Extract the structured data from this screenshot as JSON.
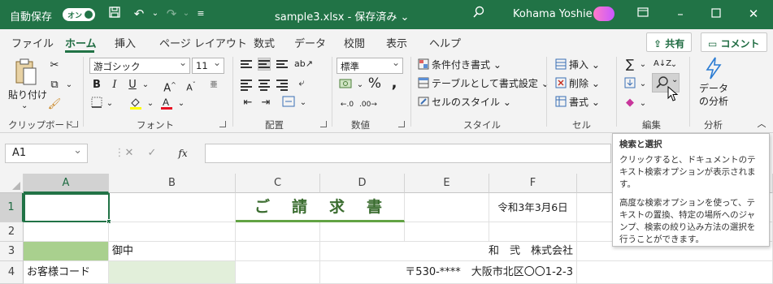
{
  "titlebar": {
    "autosave_label": "自動保存",
    "autosave_state": "オン",
    "filename": "sample3.xlsx - 保存済み ⌄",
    "user": "Kohama Yoshie",
    "bg_color": "#217346"
  },
  "tabs": [
    "ファイル",
    "ホーム",
    "挿入",
    "ページ レイアウト",
    "数式",
    "データ",
    "校閲",
    "表示",
    "ヘルプ"
  ],
  "active_tab": "ホーム",
  "share_label": "共有",
  "comment_label": "コメント",
  "ribbon": {
    "clipboard": {
      "paste": "貼り付け",
      "label": "クリップボード"
    },
    "font": {
      "name": "游ゴシック",
      "size": "11",
      "label": "フォント"
    },
    "alignment": {
      "label": "配置"
    },
    "number": {
      "format": "標準",
      "label": "数値"
    },
    "styles": {
      "conditional": "条件付き書式",
      "table": "テーブルとして書式設定",
      "cell_style": "セルのスタイル",
      "label": "スタイル"
    },
    "cells": {
      "insert": "挿入",
      "delete": "削除",
      "format": "書式",
      "label": "セル"
    },
    "editing": {
      "label": "編集"
    },
    "analysis": {
      "btn_line1": "データ",
      "btn_line2": "の分析",
      "label": "分析"
    }
  },
  "formula_bar": {
    "name_box": "A1",
    "formula": ""
  },
  "sheet": {
    "columns": [
      "A",
      "B",
      "C",
      "D",
      "E",
      "F"
    ],
    "rows": [
      "1",
      "2",
      "3",
      "4"
    ],
    "title": "ご　請　求　書",
    "date": "令和3年3月6日",
    "suffix": "御中",
    "company": "和　弐　株式会社",
    "label_code": "お客様コード",
    "address": "〒530-****　大阪市北区〇〇1-2-3"
  },
  "tooltip": {
    "title": "検索と選択",
    "p1": "クリックすると、ドキュメントのテキスト検索オプションが表示されます。",
    "p2": "高度な検索オプションを使って、テキストの置換、特定の場所へのジャンプ、検索の絞り込み方法の選択を行うことができます。"
  },
  "colors": {
    "accent": "#217346",
    "highlight_green": "#a9d08e",
    "light_green": "#e2efda",
    "font_red": "#e81123",
    "highlight_yellow": "#ffff00"
  }
}
